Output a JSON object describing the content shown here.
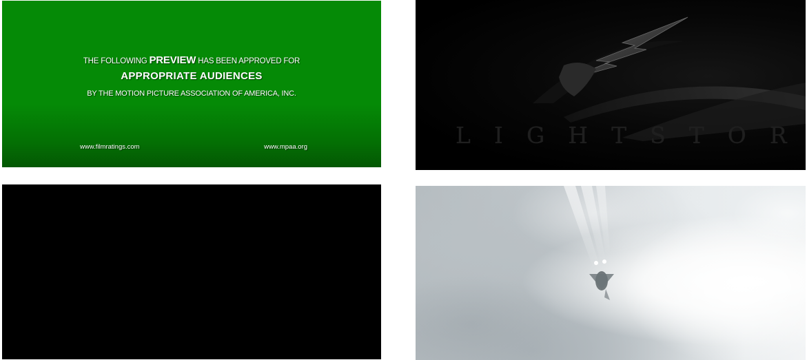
{
  "frames": {
    "green_card": {
      "line1_before": "THE FOLLOWING ",
      "line1_emphasis": "PREVIEW",
      "line1_after": " HAS BEEN APPROVED FOR",
      "line2": "APPROPRIATE AUDIENCES",
      "line3": "BY THE MOTION PICTURE ASSOCIATION OF AMERICA, INC.",
      "url_left": "www.filmratings.com",
      "url_right": "www.mpaa.org",
      "background_color": "#058a06"
    },
    "logo_card": {
      "wordmark": "LIGHTSTORM",
      "icon": "lightning-bolt-icon",
      "background_color": "#000000"
    },
    "black_card": {
      "background_color": "#000000"
    },
    "cloud_card": {
      "subject": "aircraft-in-clouds",
      "background_color": "#c9cfd2"
    }
  }
}
